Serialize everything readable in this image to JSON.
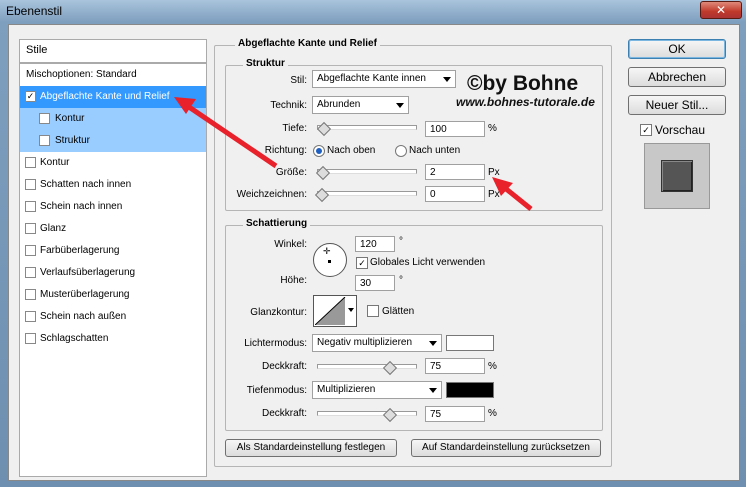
{
  "window": {
    "title": "Ebenenstil",
    "close_glyph": "✕"
  },
  "left_panel": {
    "header": "Stile",
    "items": [
      {
        "label": "Mischoptionen: Standard",
        "checkbox": false,
        "checked": false
      },
      {
        "label": "Abgeflachte Kante und Relief",
        "checkbox": true,
        "checked": true,
        "selected": true
      },
      {
        "label": "Kontur",
        "checkbox": true,
        "checked": false,
        "sub": true
      },
      {
        "label": "Struktur",
        "checkbox": true,
        "checked": false,
        "sub": true
      },
      {
        "label": "Kontur",
        "checkbox": true,
        "checked": false
      },
      {
        "label": "Schatten nach innen",
        "checkbox": true,
        "checked": false
      },
      {
        "label": "Schein nach innen",
        "checkbox": true,
        "checked": false
      },
      {
        "label": "Glanz",
        "checkbox": true,
        "checked": false
      },
      {
        "label": "Farbüberlagerung",
        "checkbox": true,
        "checked": false
      },
      {
        "label": "Verlaufsüberlagerung",
        "checkbox": true,
        "checked": false
      },
      {
        "label": "Musterüberlagerung",
        "checkbox": true,
        "checked": false
      },
      {
        "label": "Schein nach außen",
        "checkbox": true,
        "checked": false
      },
      {
        "label": "Schlagschatten",
        "checkbox": true,
        "checked": false
      }
    ]
  },
  "main": {
    "section_title": "Abgeflachte Kante und Relief",
    "struktur": {
      "title": "Struktur",
      "stil_label": "Stil:",
      "stil_value": "Abgeflachte Kante innen",
      "technik_label": "Technik:",
      "technik_value": "Abrunden",
      "tiefe_label": "Tiefe:",
      "tiefe_value": "100",
      "tiefe_unit": "%",
      "tiefe_slider": 0.02,
      "richtung_label": "Richtung:",
      "richtung_up": "Nach oben",
      "richtung_down": "Nach unten",
      "groesse_label": "Größe:",
      "groesse_value": "2",
      "groesse_unit": "Px",
      "groesse_slider": 0.01,
      "weich_label": "Weichzeichnen:",
      "weich_value": "0",
      "weich_unit": "Px",
      "weich_slider": 0.0
    },
    "schattierung": {
      "title": "Schattierung",
      "winkel_label": "Winkel:",
      "winkel_value": "120",
      "winkel_unit": "°",
      "global_label": "Globales Licht verwenden",
      "global_checked": true,
      "hoehe_label": "Höhe:",
      "hoehe_value": "30",
      "hoehe_unit": "°",
      "glanz_label": "Glanzkontur:",
      "glaetten_label": "Glätten",
      "glaetten_checked": false,
      "lichter_label": "Lichtermodus:",
      "lichter_value": "Negativ multiplizieren",
      "lichter_color": "#ffffff",
      "deckkraft1_label": "Deckkraft:",
      "deckkraft1_value": "75",
      "deckkraft1_unit": "%",
      "deckkraft1_slider": 0.75,
      "tiefen_label": "Tiefenmodus:",
      "tiefen_value": "Multiplizieren",
      "tiefen_color": "#000000",
      "deckkraft2_label": "Deckkraft:",
      "deckkraft2_value": "75",
      "deckkraft2_unit": "%",
      "deckkraft2_slider": 0.75
    },
    "btn_set_default": "Als Standardeinstellung festlegen",
    "btn_reset_default": "Auf Standardeinstellung zurücksetzen"
  },
  "right_panel": {
    "ok": "OK",
    "cancel": "Abbrechen",
    "new_style": "Neuer Stil...",
    "preview_label": "Vorschau",
    "preview_checked": true
  },
  "watermark": {
    "line1": "©by Bohne",
    "line2": "www.bohnes-tutorale.de"
  },
  "colors": {
    "accent": "#3399ff",
    "sub_selected": "#99ccff",
    "arrow": "#e8212b"
  }
}
